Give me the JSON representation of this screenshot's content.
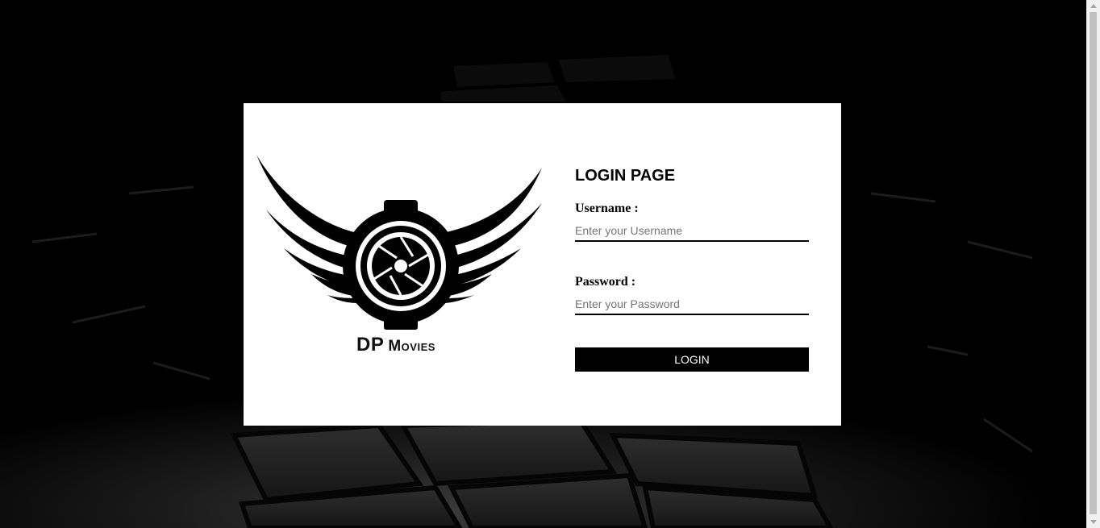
{
  "brand": {
    "name_main": "DP",
    "name_sub": "Movies"
  },
  "login": {
    "title": "LOGIN PAGE",
    "username_label": "Username :",
    "username_placeholder": "Enter your Username",
    "password_label": "Password :",
    "password_placeholder": "Enter your Password",
    "button_label": "LOGIN"
  },
  "icons": {
    "logo": "winged-camera-aperture-icon"
  },
  "colors": {
    "page_background": "#000000",
    "card_background": "#ffffff",
    "button_background": "#000000",
    "button_text": "#ffffff"
  }
}
